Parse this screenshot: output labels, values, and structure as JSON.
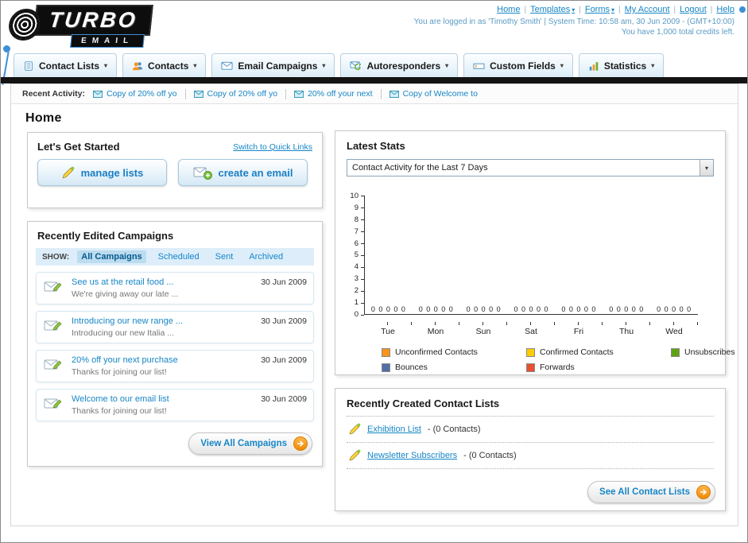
{
  "header": {
    "logo_primary": "TURBO",
    "logo_secondary": "EMAIL",
    "links": [
      {
        "label": "Home",
        "has_menu": false
      },
      {
        "label": "Templates",
        "has_menu": true
      },
      {
        "label": "Forms",
        "has_menu": true
      },
      {
        "label": "My Account",
        "has_menu": false
      },
      {
        "label": "Logout",
        "has_menu": false
      },
      {
        "label": "Help",
        "has_menu": false
      }
    ],
    "login_info": "You are logged in as 'Timothy Smith' | System Time: 10:58 am, 30 Jun 2009 - (GMT+10:00)",
    "credits_info": "You have 1,000 total credits left."
  },
  "main_nav": {
    "tabs": [
      {
        "label": "Contact Lists",
        "icon": "contact-lists-icon"
      },
      {
        "label": "Contacts",
        "icon": "contacts-icon"
      },
      {
        "label": "Email Campaigns",
        "icon": "email-campaigns-icon"
      },
      {
        "label": "Autoresponders",
        "icon": "autoresponders-icon"
      },
      {
        "label": "Custom Fields",
        "icon": "custom-fields-icon"
      },
      {
        "label": "Statistics",
        "icon": "statistics-icon"
      }
    ]
  },
  "recent_activity": {
    "label": "Recent Activity:",
    "items": [
      "Copy of 20% off yo",
      "Copy of 20% off yo",
      "20% off your next",
      "Copy of Welcome to"
    ]
  },
  "page": {
    "title": "Home"
  },
  "get_started_panel": {
    "title": "Let's Get Started",
    "switch_link": "Switch to Quick Links",
    "manage_lists_label": "manage lists",
    "create_email_label": "create an email"
  },
  "campaigns_panel": {
    "title": "Recently Edited Campaigns",
    "show_label": "SHOW:",
    "filters": [
      "All Campaigns",
      "Scheduled",
      "Sent",
      "Archived"
    ],
    "active_filter": "All Campaigns",
    "items": [
      {
        "title": "See us at the retail food ...",
        "subtitle": "We're giving away our late ...",
        "date": "30 Jun 2009"
      },
      {
        "title": "Introducing our new range ...",
        "subtitle": "Introducing our new Italia ...",
        "date": "30 Jun 2009"
      },
      {
        "title": "20% off your next purchase",
        "subtitle": "Thanks for joining our list!",
        "date": "30 Jun 2009"
      },
      {
        "title": "Welcome to our email list",
        "subtitle": "Thanks for joining our list!",
        "date": "30 Jun 2009"
      }
    ],
    "view_all_label": "View All Campaigns"
  },
  "stats_panel": {
    "title": "Latest Stats",
    "period_select_value": "Contact Activity for the Last 7 Days",
    "zeros_label": "0 0 0 0 0"
  },
  "chart_data": {
    "type": "bar",
    "title": "Contact Activity for the Last 7 Days",
    "categories": [
      "Tue",
      "Mon",
      "Sun",
      "Sat",
      "Fri",
      "Thu",
      "Wed"
    ],
    "series": [
      {
        "name": "Unconfirmed Contacts",
        "color": "#f7941d",
        "values": [
          0,
          0,
          0,
          0,
          0,
          0,
          0
        ]
      },
      {
        "name": "Confirmed Contacts",
        "color": "#ffcc00",
        "values": [
          0,
          0,
          0,
          0,
          0,
          0,
          0
        ]
      },
      {
        "name": "Unsubscribes",
        "color": "#5fa315",
        "values": [
          0,
          0,
          0,
          0,
          0,
          0,
          0
        ]
      },
      {
        "name": "Bounces",
        "color": "#4f6fa8",
        "values": [
          0,
          0,
          0,
          0,
          0,
          0,
          0
        ]
      },
      {
        "name": "Forwards",
        "color": "#e8502e",
        "values": [
          0,
          0,
          0,
          0,
          0,
          0,
          0
        ]
      }
    ],
    "ylim": [
      0,
      10
    ],
    "yticks": [
      10,
      9,
      8,
      7,
      6,
      5,
      4,
      3,
      2,
      1,
      0
    ],
    "grid": false,
    "legend_position": "bottom",
    "value_labels_per_group": "0 0 0 0 0"
  },
  "contact_lists_panel": {
    "title": "Recently Created Contact Lists",
    "items": [
      {
        "name": "Exhibition List",
        "detail": "- (0 Contacts)"
      },
      {
        "name": "Newsletter Subscribers",
        "detail": "- (0 Contacts)"
      }
    ],
    "see_all_label": "See All Contact Lists"
  },
  "colors": {
    "link_blue": "#1786c6",
    "accent_orange": "#f7941d",
    "nav_bar_black": "#141414"
  }
}
